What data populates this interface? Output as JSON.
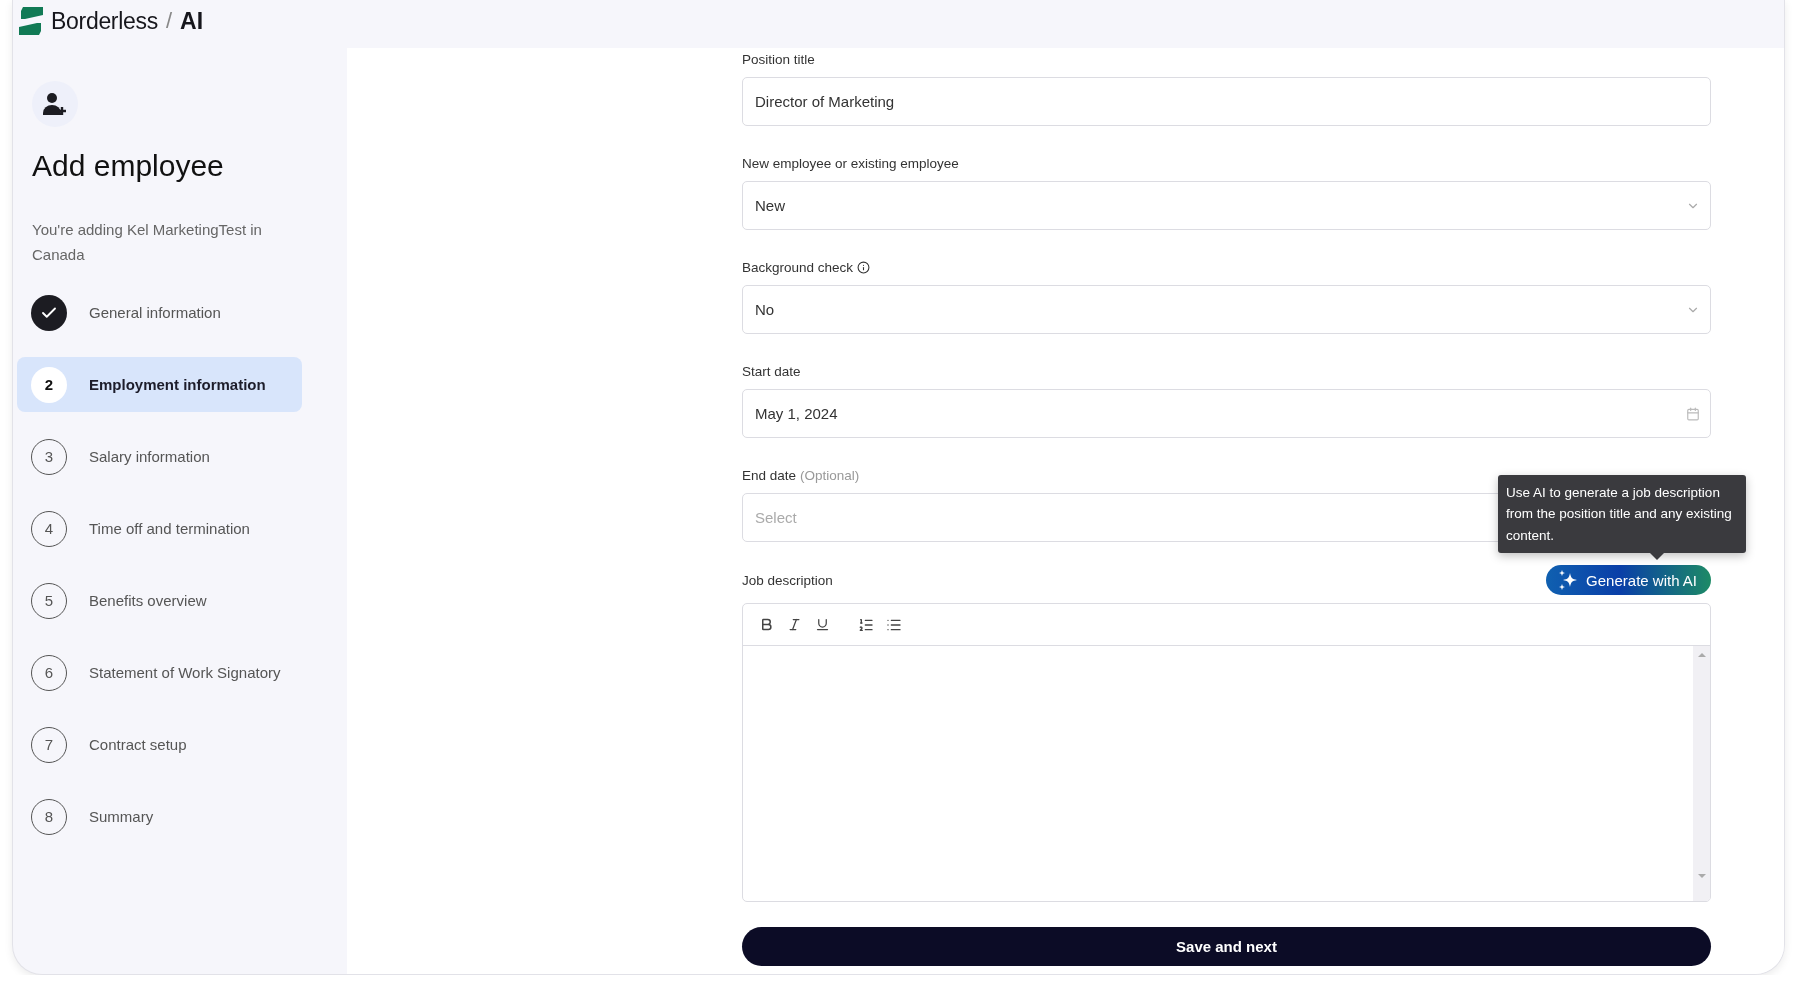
{
  "brand": {
    "name": "Borderless",
    "separator": "/",
    "suffix": "AI"
  },
  "sidebar": {
    "title": "Add employee",
    "subtitle": "You're adding Kel MarketingTest in Canada",
    "steps": [
      {
        "label": "General information",
        "completed": true,
        "selected": false
      },
      {
        "number": "2",
        "label": "Employment information",
        "completed": false,
        "selected": true
      },
      {
        "number": "3",
        "label": "Salary information",
        "completed": false,
        "selected": false
      },
      {
        "number": "4",
        "label": "Time off and termination",
        "completed": false,
        "selected": false
      },
      {
        "number": "5",
        "label": "Benefits overview",
        "completed": false,
        "selected": false
      },
      {
        "number": "6",
        "label": "Statement of Work Signatory",
        "completed": false,
        "selected": false
      },
      {
        "number": "7",
        "label": "Contract setup",
        "completed": false,
        "selected": false
      },
      {
        "number": "8",
        "label": "Summary",
        "completed": false,
        "selected": false
      }
    ]
  },
  "form": {
    "fields": [
      {
        "kind": "text",
        "label": "Position title",
        "value": "Director of Marketing"
      },
      {
        "kind": "select",
        "label": "New employee or existing employee",
        "value": "New"
      },
      {
        "kind": "select",
        "label": "Background check",
        "info": true,
        "value": "No"
      },
      {
        "kind": "date",
        "label": "Start date",
        "value": "May 1, 2024"
      },
      {
        "kind": "text",
        "label": "End date",
        "note": "(Optional)",
        "placeholder": "Select"
      }
    ],
    "job_description": {
      "label": "Job description",
      "ai_button": "Generate with AI",
      "tooltip": "Use AI to generate a job description from the position title and any existing content."
    },
    "submit": "Save and next"
  }
}
